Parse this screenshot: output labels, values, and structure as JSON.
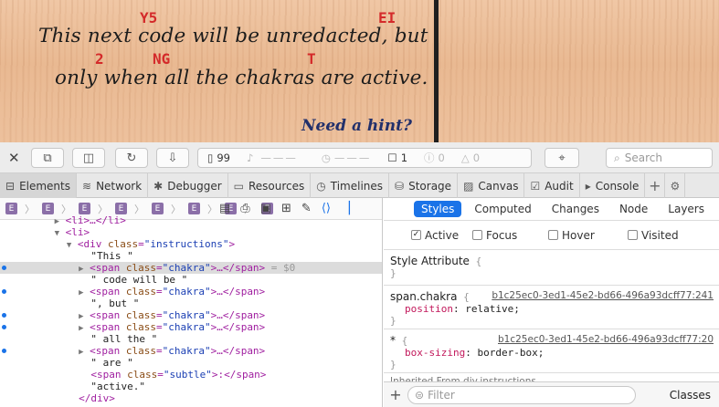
{
  "page": {
    "line1": "This next code will be unredacted, but",
    "line2": "only when all the chakras are active.",
    "hint": "Need a hint?",
    "redacted": {
      "y5": "Y5",
      "ei": "EI",
      "two": "2",
      "ng": "NG",
      "t": "T"
    }
  },
  "toolbar": {
    "resources_count": "99",
    "messages_count": "1",
    "errors_count": "0",
    "warnings_count": "0",
    "search_placeholder": "Search"
  },
  "tabs": [
    {
      "label": "Elements",
      "icon": "elements-icon"
    },
    {
      "label": "Network",
      "icon": "network-icon"
    },
    {
      "label": "Debugger",
      "icon": "debugger-icon"
    },
    {
      "label": "Resources",
      "icon": "resources-icon"
    },
    {
      "label": "Timelines",
      "icon": "timelines-icon"
    },
    {
      "label": "Storage",
      "icon": "storage-icon"
    },
    {
      "label": "Canvas",
      "icon": "canvas-icon"
    },
    {
      "label": "Audit",
      "icon": "audit-icon"
    },
    {
      "label": "Console",
      "icon": "console-icon"
    }
  ],
  "breadcrumb": {
    "badge": "E"
  },
  "dom": {
    "r0_text": "<li>…</li>",
    "r1_tag": "<li>",
    "r2_open": "<div ",
    "r2_attr": "class",
    "r2_val": "\"instructions\"",
    "r2_close": ">",
    "r3_text": "\"This \"",
    "span_open": "<span ",
    "attr_class": "class",
    "val_chakra": "\"chakra\"",
    "span_close": ">…</span>",
    "eq0": " = $0",
    "r5_text": "\" code will be \"",
    "r7_text": "\", but \"",
    "r10_text": "\" all the \"",
    "r12_text": "\" are \"",
    "val_subtle": "\"subtle\"",
    "span_subtle_close": ">:</span>",
    "r14_text": "\"active.\"",
    "r15_close": "</div>"
  },
  "styles": {
    "tabs": [
      "Styles",
      "Computed",
      "Changes",
      "Node",
      "Layers"
    ],
    "pseudo": [
      {
        "label": "Active",
        "checked": true
      },
      {
        "label": "Focus",
        "checked": false
      },
      {
        "label": "Hover",
        "checked": false
      },
      {
        "label": "Visited",
        "checked": false
      }
    ],
    "style_attribute": "Style Attribute",
    "rule1": {
      "selector": "span.chakra",
      "source": "b1c25ec0-3ed1-45e2-bd66-496a93dcff77:241",
      "prop": "position",
      "value": "relative"
    },
    "rule2": {
      "selector": "*",
      "source": "b1c25ec0-3ed1-45e2-bd66-496a93dcff77:20",
      "prop": "box-sizing",
      "value": "border-box"
    },
    "inherited": "Inherited From div.instructions",
    "filter_placeholder": "Filter",
    "classes_label": "Classes"
  }
}
